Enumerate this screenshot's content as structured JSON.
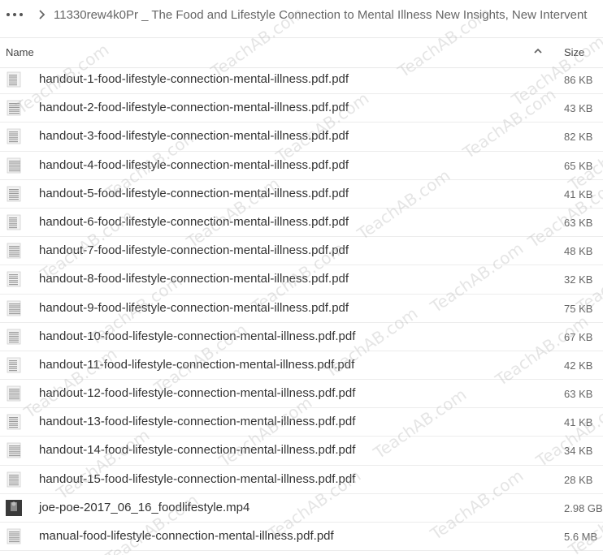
{
  "topbar": {
    "more_icon": "more-horizontal-icon",
    "separator_icon": "chevron-right-icon",
    "breadcrumb": "11330rew4k0Pr _ The Food and Lifestyle Connection to Mental Illness New Insights, New Intervent"
  },
  "header": {
    "name_label": "Name",
    "sort_icon": "chevron-up-icon",
    "size_label": "Size"
  },
  "files": [
    {
      "name": "handout-1-food-lifestyle-connection-mental-illness.pdf.pdf",
      "size": "86 KB",
      "icon": "pdf-thumbnail-icon"
    },
    {
      "name": "handout-2-food-lifestyle-connection-mental-illness.pdf.pdf",
      "size": "43 KB",
      "icon": "pdf-thumbnail-icon"
    },
    {
      "name": "handout-3-food-lifestyle-connection-mental-illness.pdf.pdf",
      "size": "82 KB",
      "icon": "pdf-thumbnail-icon"
    },
    {
      "name": "handout-4-food-lifestyle-connection-mental-illness.pdf.pdf",
      "size": "65 KB",
      "icon": "pdf-thumbnail-icon"
    },
    {
      "name": "handout-5-food-lifestyle-connection-mental-illness.pdf.pdf",
      "size": "41 KB",
      "icon": "pdf-thumbnail-icon"
    },
    {
      "name": "handout-6-food-lifestyle-connection-mental-illness.pdf.pdf",
      "size": "63 KB",
      "icon": "pdf-thumbnail-icon"
    },
    {
      "name": "handout-7-food-lifestyle-connection-mental-illness.pdf.pdf",
      "size": "48 KB",
      "icon": "pdf-thumbnail-icon"
    },
    {
      "name": "handout-8-food-lifestyle-connection-mental-illness.pdf.pdf",
      "size": "32 KB",
      "icon": "pdf-thumbnail-icon"
    },
    {
      "name": "handout-9-food-lifestyle-connection-mental-illness.pdf.pdf",
      "size": "75 KB",
      "icon": "pdf-thumbnail-icon"
    },
    {
      "name": "handout-10-food-lifestyle-connection-mental-illness.pdf.pdf",
      "size": "67 KB",
      "icon": "pdf-thumbnail-icon"
    },
    {
      "name": "handout-11-food-lifestyle-connection-mental-illness.pdf.pdf",
      "size": "42 KB",
      "icon": "pdf-thumbnail-icon"
    },
    {
      "name": "handout-12-food-lifestyle-connection-mental-illness.pdf.pdf",
      "size": "63 KB",
      "icon": "pdf-thumbnail-icon"
    },
    {
      "name": "handout-13-food-lifestyle-connection-mental-illness.pdf.pdf",
      "size": "41 KB",
      "icon": "pdf-thumbnail-icon"
    },
    {
      "name": "handout-14-food-lifestyle-connection-mental-illness.pdf.pdf",
      "size": "34 KB",
      "icon": "pdf-thumbnail-icon"
    },
    {
      "name": "handout-15-food-lifestyle-connection-mental-illness.pdf.pdf",
      "size": "28 KB",
      "icon": "pdf-thumbnail-icon"
    },
    {
      "name": "joe-poe-2017_06_16_foodlifestyle.mp4",
      "size": "2.98 GB",
      "icon": "video-thumbnail-icon"
    },
    {
      "name": "manual-food-lifestyle-connection-mental-illness.pdf.pdf",
      "size": "5.6 MB",
      "icon": "pdf-thumbnail-icon"
    }
  ],
  "watermark": "TeachAB.com"
}
